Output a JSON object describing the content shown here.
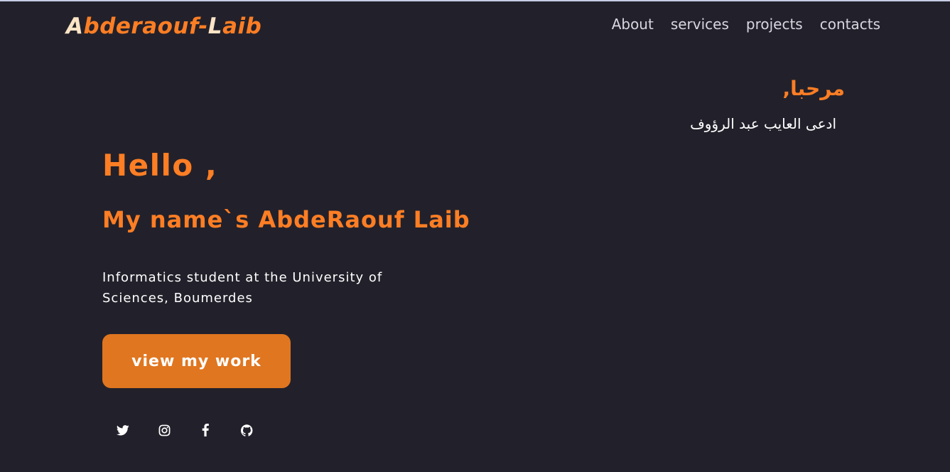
{
  "header": {
    "logo_first": "A",
    "logo_rest_1": "bderaouf-",
    "logo_second": "L",
    "logo_rest_2": "aib",
    "nav": [
      {
        "label": "About"
      },
      {
        "label": "services"
      },
      {
        "label": "projects"
      },
      {
        "label": "contacts"
      }
    ]
  },
  "hero": {
    "arabic_greeting": "مرحبا,",
    "arabic_name": "ادعى العايب عبد الرؤوف",
    "hello": "Hello ,",
    "name": "My name`s AbdeRaouf Laib",
    "bio": "Informatics student at the University of Sciences, Boumerdes",
    "cta_label": "view my work"
  },
  "socials": [
    {
      "icon": "twitter-icon"
    },
    {
      "icon": "instagram-icon"
    },
    {
      "icon": "facebook-icon"
    },
    {
      "icon": "github-icon"
    }
  ],
  "colors": {
    "background": "#22212b",
    "accent": "#fe7e24",
    "button": "#e07620",
    "text": "#ffffff",
    "nav_text": "#d9d6e0"
  }
}
